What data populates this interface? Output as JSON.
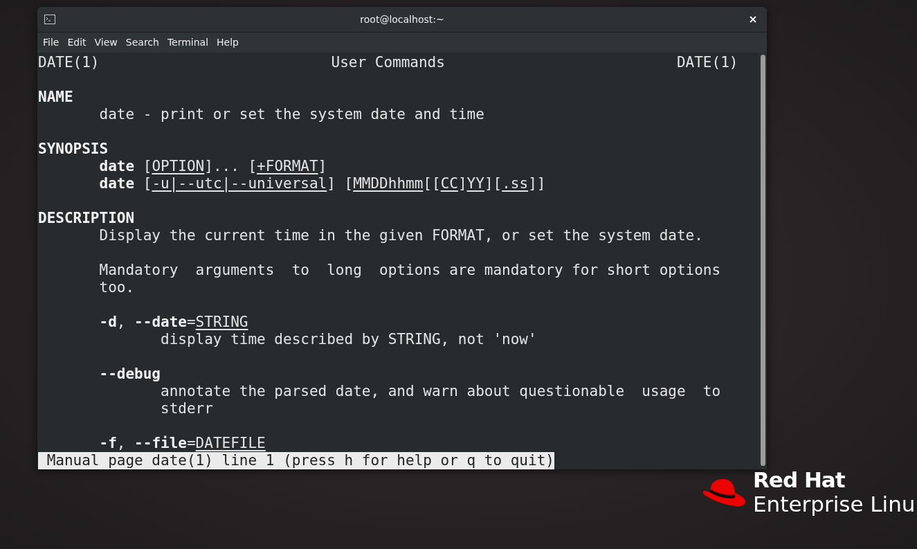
{
  "window": {
    "title": "root@localhost:~"
  },
  "menu": [
    "File",
    "Edit",
    "View",
    "Search",
    "Terminal",
    "Help"
  ],
  "terminal": {
    "lines": [
      {
        "kind": "header",
        "segments": [
          {
            "text": "DATE(1)",
            "kind": "plain"
          },
          {
            "text": "User Commands",
            "kind": "plain"
          },
          {
            "text": "DATE(1)",
            "kind": "plain"
          }
        ]
      },
      {
        "kind": "blank"
      },
      {
        "kind": "section",
        "segments": [
          {
            "text": "NAME",
            "kind": "bold"
          }
        ]
      },
      {
        "kind": "body",
        "segments": [
          {
            "text": "date - print or set the system date and time",
            "kind": "plain"
          }
        ]
      },
      {
        "kind": "blank"
      },
      {
        "kind": "section",
        "segments": [
          {
            "text": "SYNOPSIS",
            "kind": "bold"
          }
        ]
      },
      {
        "kind": "body",
        "segments": [
          {
            "text": "date",
            "kind": "bold"
          },
          {
            "text": " [",
            "kind": "plain"
          },
          {
            "text": "OPTION",
            "kind": "underline"
          },
          {
            "text": "]... [",
            "kind": "plain"
          },
          {
            "text": "+FORMAT",
            "kind": "underline"
          },
          {
            "text": "]",
            "kind": "plain"
          }
        ]
      },
      {
        "kind": "body",
        "segments": [
          {
            "text": "date",
            "kind": "bold"
          },
          {
            "text": " [",
            "kind": "plain"
          },
          {
            "text": "-u|--utc|--universal",
            "kind": "underline"
          },
          {
            "text": "] [",
            "kind": "plain"
          },
          {
            "text": "MMDDhhmm",
            "kind": "underline"
          },
          {
            "text": "[[",
            "kind": "plain"
          },
          {
            "text": "CC",
            "kind": "underline"
          },
          {
            "text": "]",
            "kind": "plain"
          },
          {
            "text": "YY",
            "kind": "underline"
          },
          {
            "text": "][",
            "kind": "plain"
          },
          {
            "text": ".ss",
            "kind": "underline"
          },
          {
            "text": "]]",
            "kind": "plain"
          }
        ]
      },
      {
        "kind": "blank"
      },
      {
        "kind": "section",
        "segments": [
          {
            "text": "DESCRIPTION",
            "kind": "bold"
          }
        ]
      },
      {
        "kind": "body",
        "segments": [
          {
            "text": "Display the current time in the given FORMAT, or set the system date.",
            "kind": "plain"
          }
        ]
      },
      {
        "kind": "blank"
      },
      {
        "kind": "body",
        "segments": [
          {
            "text": "Mandatory  arguments  to  long  options are mandatory for short options",
            "kind": "plain"
          }
        ]
      },
      {
        "kind": "body",
        "segments": [
          {
            "text": "too.",
            "kind": "plain"
          }
        ]
      },
      {
        "kind": "blank"
      },
      {
        "kind": "body",
        "segments": [
          {
            "text": "-d",
            "kind": "bold"
          },
          {
            "text": ", ",
            "kind": "plain"
          },
          {
            "text": "--date",
            "kind": "bold"
          },
          {
            "text": "=",
            "kind": "plain"
          },
          {
            "text": "STRING",
            "kind": "underline"
          }
        ]
      },
      {
        "kind": "option_desc",
        "segments": [
          {
            "text": "display time described by STRING, not 'now'",
            "kind": "plain"
          }
        ]
      },
      {
        "kind": "blank"
      },
      {
        "kind": "body",
        "segments": [
          {
            "text": "--debug",
            "kind": "bold"
          }
        ]
      },
      {
        "kind": "option_desc",
        "segments": [
          {
            "text": "annotate the parsed date, and warn about questionable  usage  to",
            "kind": "plain"
          }
        ]
      },
      {
        "kind": "option_desc",
        "segments": [
          {
            "text": "stderr",
            "kind": "plain"
          }
        ]
      },
      {
        "kind": "blank"
      },
      {
        "kind": "body",
        "segments": [
          {
            "text": "-f",
            "kind": "bold"
          },
          {
            "text": ", ",
            "kind": "plain"
          },
          {
            "text": "--file",
            "kind": "bold"
          },
          {
            "text": "=",
            "kind": "plain"
          },
          {
            "text": "DATEFILE",
            "kind": "underline"
          }
        ]
      }
    ],
    "status": "Manual page date(1) line 1 (press h for help or q to quit)"
  },
  "logo": {
    "line_1": "Red Hat",
    "line_2": "Enterprise Linu"
  }
}
